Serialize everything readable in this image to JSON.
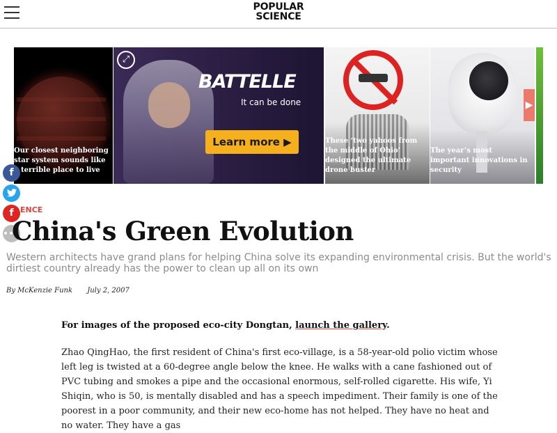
{
  "header": {
    "logo_line1": "POPULAR",
    "logo_line2": "SCIENCE",
    "menu_icon": "hamburger-menu-icon"
  },
  "carousel": {
    "tiles": [
      {
        "caption": "Our closest neighboring star system sounds like a terrible place to live",
        "image": "red-planet"
      },
      {
        "ad_brand": "BATTELLE",
        "ad_tagline": "It can be done",
        "ad_button": "Learn more ▶",
        "expand_icon": "expand-icon"
      },
      {
        "caption": "These ‘two yahoos from the middle of Ohio’ designed the ultimate drone buster",
        "image": "no-drone-sign"
      },
      {
        "caption": "The year’s most important innovations in security",
        "image": "security-camera"
      },
      {
        "image": "green-tile"
      }
    ],
    "next_icon": "▶"
  },
  "share": {
    "facebook": "f",
    "twitter": "t",
    "flipboard": "f",
    "more": "•••"
  },
  "article": {
    "kicker": "ENCE",
    "title": "China's Green Evolution",
    "dek": "Western architects have grand plans for helping China solve its expanding environmental crisis. But the world's dirtiest country already has the power to clean up all on its own",
    "author": "By McKenzie Funk",
    "date": "July 2, 2007",
    "lead_prefix": "For images of the proposed eco-city Dongtan,",
    "lead_link": "launch the gallery",
    "lead_suffix": ".",
    "body_text": "Zhao QingHao, the first resident of China's first eco-village, is a 58-year-old polio victim whose left leg is twisted at a 60-degree angle below the knee. He walks with a cane fashioned out of PVC tubing and smokes a pipe and the occasional enormous, self-rolled cigarette. His wife, Yi Shiqin, who is 50, is mentally disabled and has a speech impediment. Their family is one of the poorest in a poor community, and their new eco-home has not helped. They have no heat and no water. They have a gas"
  }
}
